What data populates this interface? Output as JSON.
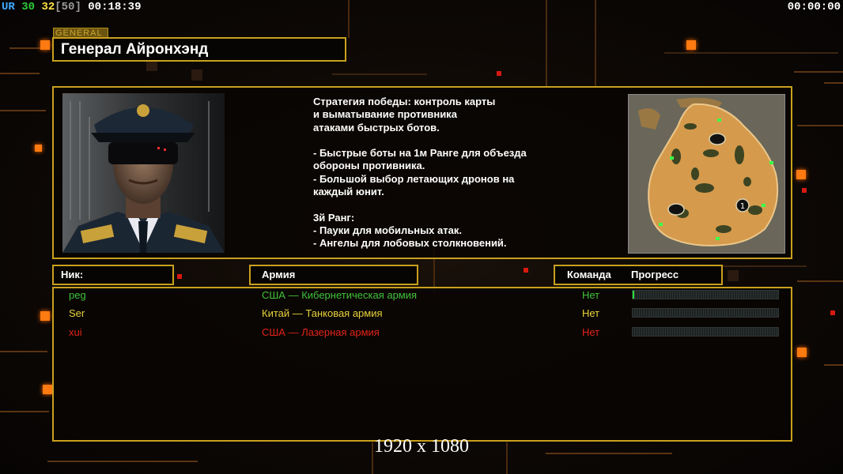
{
  "hud": {
    "fps_ur": "UR",
    "fps_a": "30",
    "fps_b": "32",
    "fps_cap": "[50]",
    "game_time": "00:18:39",
    "timer_right": "00:00:00",
    "colors": {
      "ur": "#3fa9ff",
      "a": "#2ecc3a",
      "b": "#ffe14a",
      "cap": "#9a9a9a"
    }
  },
  "general": {
    "tag": "GENERAL",
    "name": "Генерал Айронхэнд",
    "description": "Стратегия победы: контроль карты\nи выматывание противника\nатаками быстрых ботов.\n\n- Быстрые боты на 1м Ранге для объезда\n обороны противника.\n- Большой выбор летающих дронов на\n каждый юнит.\n\n3й Ранг:\n- Пауки для мобильных атак.\n- Ангелы для лобовых столкновений.",
    "portrait_icon": "general-portrait",
    "minimap_icon": "map-preview",
    "minimap_marker": "1"
  },
  "columns": {
    "nick": "Ник:",
    "army": "Армия",
    "team": "Команда",
    "progress": "Прогресс"
  },
  "players": [
    {
      "nick": "peg",
      "army": "США — Кибернетическая армия",
      "team": "Нет",
      "color": "#3fc23a",
      "progress": 0.01
    },
    {
      "nick": "Ser",
      "army": "Китай — Танковая армия",
      "team": "Нет",
      "color": "#e8d23c",
      "progress": 0
    },
    {
      "nick": "xui",
      "army": "США — Лазерная армия",
      "team": "Нет",
      "color": "#e3231a",
      "progress": 0
    }
  ],
  "resolution": "1920 x 1080"
}
